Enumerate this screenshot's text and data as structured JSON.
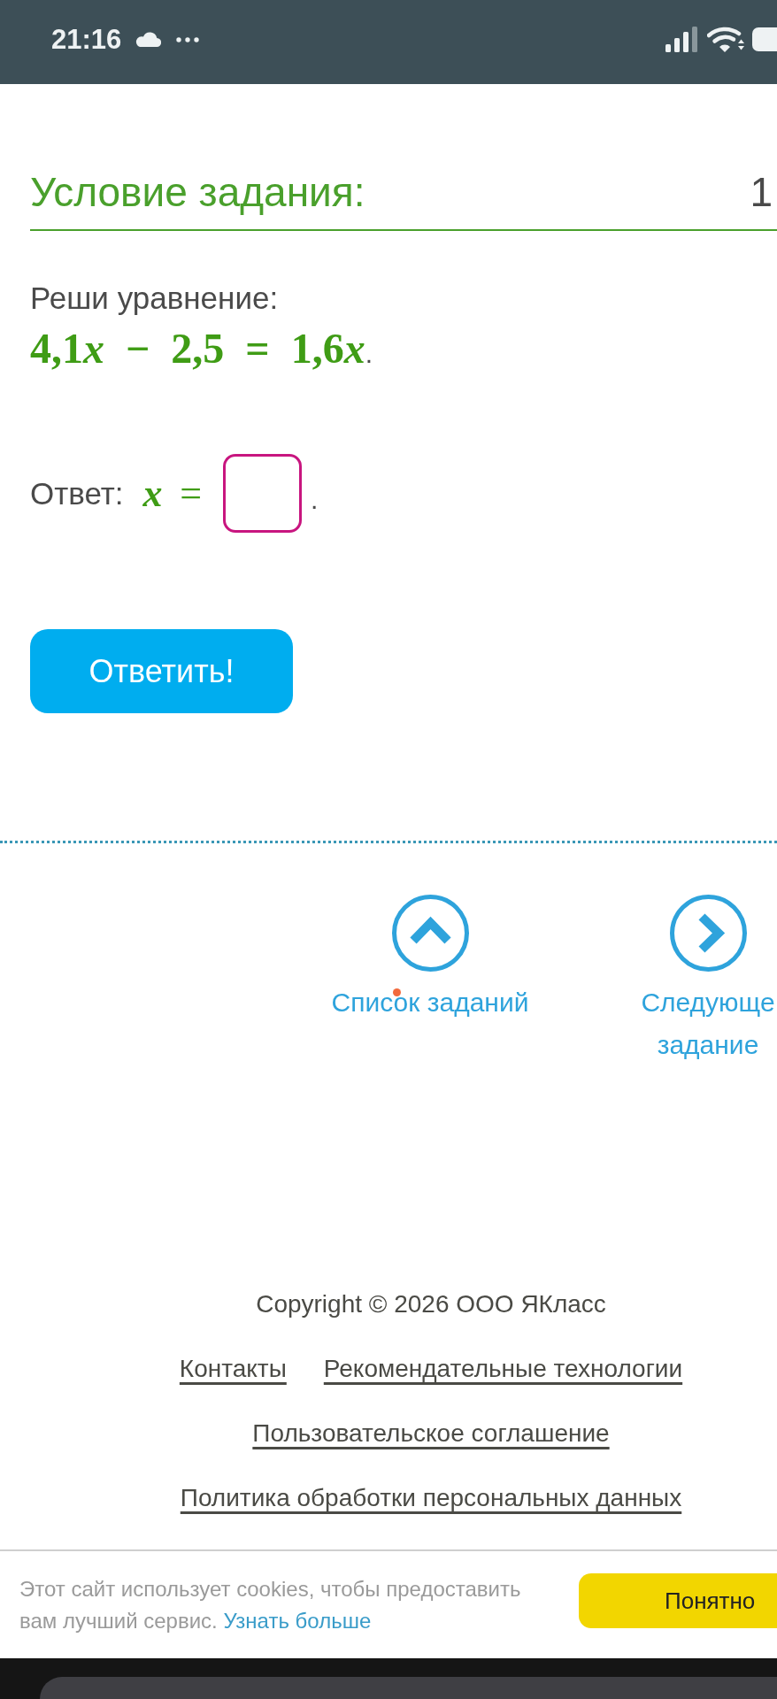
{
  "status_bar": {
    "time": "21:16"
  },
  "task": {
    "heading": "Условие задания:",
    "points": "1",
    "prompt": "Реши уравнение:",
    "equation": [
      {
        "kind": "number",
        "text": "4,1"
      },
      {
        "kind": "variable",
        "text": "x"
      },
      {
        "kind": "operator",
        "text": "−"
      },
      {
        "kind": "number",
        "text": "2,5"
      },
      {
        "kind": "operator",
        "text": "="
      },
      {
        "kind": "number",
        "text": "1,6"
      },
      {
        "kind": "variable",
        "text": "x"
      }
    ],
    "equation_end": "."
  },
  "answer": {
    "label": "Ответ:",
    "math": [
      {
        "kind": "variable",
        "text": "x"
      },
      {
        "kind": "operator",
        "text": "="
      }
    ],
    "end": "."
  },
  "submit_button": {
    "label": "Ответить!"
  },
  "navigation": [
    {
      "kind": "list",
      "label": "Список заданий"
    },
    {
      "kind": "next",
      "label": "Следующе задание"
    }
  ],
  "footer": {
    "copyright": "Copyright © 2026 ООО ЯКласс",
    "link_rows": [
      [
        "Контакты",
        "Рекомендательные технологии"
      ],
      [
        "Пользовательское соглашение"
      ],
      [
        "Политика обработки персональных данных"
      ]
    ]
  },
  "cookie_banner": {
    "text": "Этот сайт использует cookies, чтобы предоставить вам лучший сервис.",
    "link": "Узнать больше",
    "button": "Понятно"
  }
}
